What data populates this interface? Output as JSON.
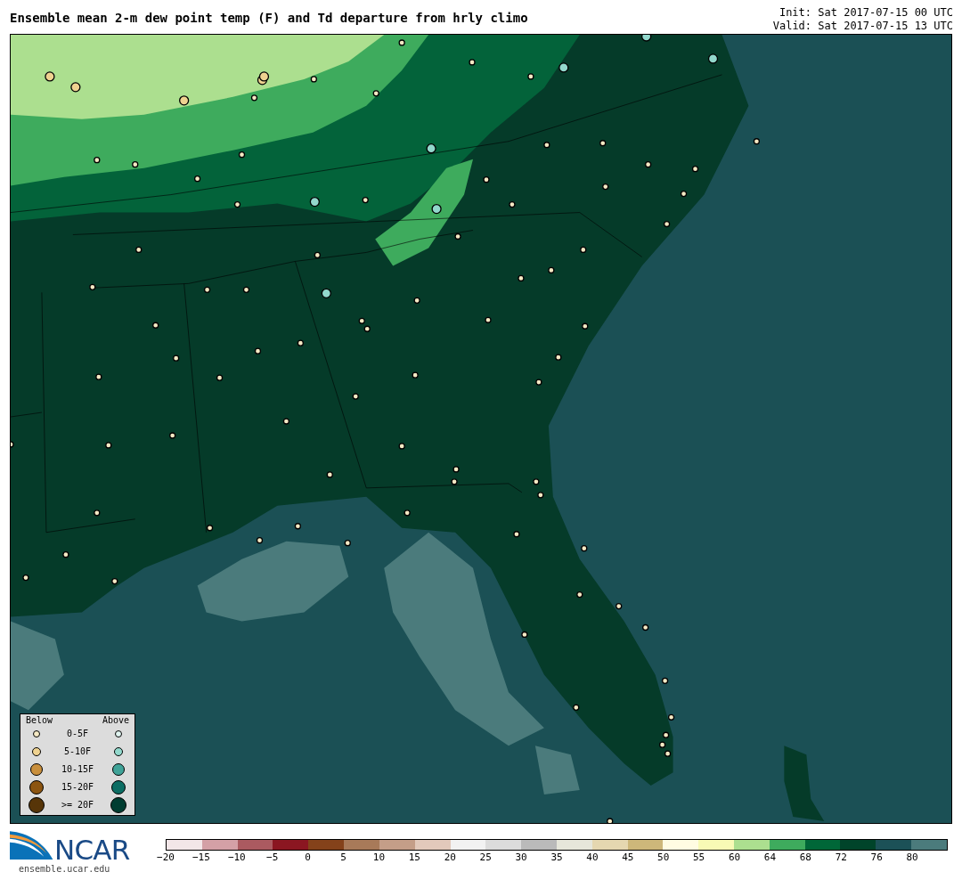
{
  "title": "Ensemble mean 2-m dew point temp (F) and Td departure from hrly climo",
  "init": "Init: Sat 2017-07-15 00 UTC",
  "valid": "Valid: Sat 2017-07-15 13 UTC",
  "legend": {
    "below_heading": "Below",
    "above_heading": "Above",
    "rows": [
      {
        "label": "0-5F",
        "below": {
          "color": "#f5e9c4"
        },
        "above": {
          "color": "#e0f4f0"
        }
      },
      {
        "label": "5-10F",
        "below": {
          "color": "#efd290"
        },
        "above": {
          "color": "#92d8cc"
        }
      },
      {
        "label": "10-15F",
        "below": {
          "color": "#c98f3c"
        },
        "above": {
          "color": "#40a398"
        }
      },
      {
        "label": "15-20F",
        "below": {
          "color": "#8c5511"
        },
        "above": {
          "color": "#0c6d63"
        }
      },
      {
        "label": ">= 20F",
        "below": {
          "color": "#573508"
        },
        "above": {
          "color": "#003d31"
        }
      }
    ]
  },
  "logo": {
    "wordmark": "NCAR",
    "url": "ensemble.ucar.edu"
  },
  "colorbar": {
    "segments": [
      {
        "color": "#f3e6e8"
      },
      {
        "color": "#d4a0a6"
      },
      {
        "color": "#ab5a60"
      },
      {
        "color": "#8b1621"
      },
      {
        "color": "#84421a"
      },
      {
        "color": "#a87a59"
      },
      {
        "color": "#c49e88"
      },
      {
        "color": "#e2c9bb"
      },
      {
        "color": "#f2f2f2"
      },
      {
        "color": "#dcdcdc"
      },
      {
        "color": "#bababa"
      },
      {
        "color": "#e6e6da"
      },
      {
        "color": "#e5d7b0"
      },
      {
        "color": "#cdb77a"
      },
      {
        "color": "#fffce2"
      },
      {
        "color": "#f8fab5"
      },
      {
        "color": "#acdf8f"
      },
      {
        "color": "#3eab5d"
      },
      {
        "color": "#006738"
      },
      {
        "color": "#00442a"
      },
      {
        "color": "#1c5157"
      },
      {
        "color": "#4b7b7c"
      }
    ],
    "ticks": [
      "−20",
      "−15",
      "−10",
      "−5",
      "0",
      "5",
      "10",
      "15",
      "20",
      "25",
      "30",
      "35",
      "40",
      "45",
      "50",
      "55",
      "60",
      "64",
      "68",
      "72",
      "76",
      "80"
    ]
  }
}
